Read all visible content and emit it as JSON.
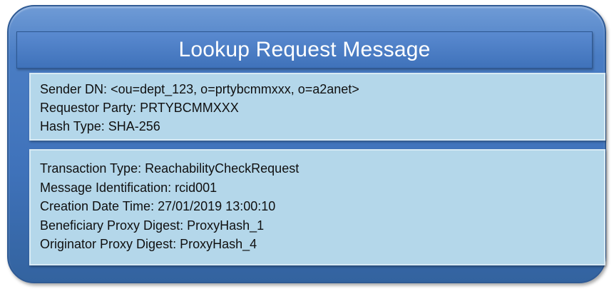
{
  "title": "Lookup Request Message",
  "header_section": {
    "lines": [
      {
        "label": "Sender DN:",
        "value": "<ou=dept_123, o=prtybcmmxxx, o=a2anet>"
      },
      {
        "label": "Requestor Party:",
        "value": "PRTYBCMMXXX"
      },
      {
        "label": "Hash Type:",
        "value": "SHA-256"
      }
    ]
  },
  "body_section": {
    "lines": [
      {
        "label": "Transaction Type:",
        "value": "ReachabilityCheckRequest"
      },
      {
        "label": "Message Identification:",
        "value": "rcid001"
      },
      {
        "label": "Creation Date Time:",
        "value": "27/01/2019 13:00:10"
      },
      {
        "label": "Beneficiary Proxy Digest:",
        "value": "ProxyHash_1"
      },
      {
        "label": "Originator Proxy Digest:",
        "value": "ProxyHash_4"
      }
    ]
  },
  "colors": {
    "outer_fill": "#4a7dc4",
    "title_text": "#ffffff",
    "panel_fill": "#b4d7ea",
    "text": "#101010"
  }
}
